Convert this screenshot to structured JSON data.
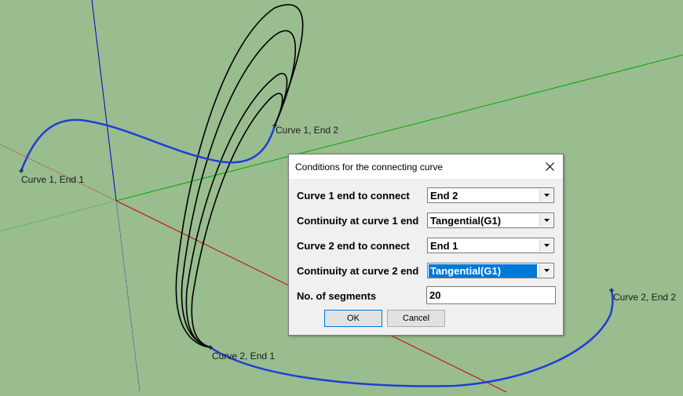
{
  "viewport_labels": {
    "curve1_end1": "Curve 1, End 1",
    "curve1_end2": "Curve 1, End 2",
    "curve2_end1": "Curve 2, End 1",
    "curve2_end2": "Curve 2, End 2"
  },
  "colors": {
    "background": "#99bd8f",
    "blue_axis": "#0000cc",
    "green_axis": "#00aa00",
    "red_axis": "#cc0000",
    "curve": "#1e3fd8",
    "connecting_curve": "#000000",
    "selection": "#0078d7"
  },
  "dialog": {
    "title": "Conditions for the connecting curve",
    "close_icon": "close-icon",
    "rows": [
      {
        "label": "Curve 1 end to connect",
        "value": "End 2"
      },
      {
        "label": "Continuity at curve 1 end",
        "value": "Tangential(G1)"
      },
      {
        "label": "Curve 2 end to connect",
        "value": "End 1"
      },
      {
        "label": "Continuity at curve 2 end",
        "value": "Tangential(G1)"
      }
    ],
    "segments_label": "No. of segments",
    "segments_value": "20",
    "ok_label": "OK",
    "cancel_label": "Cancel"
  }
}
